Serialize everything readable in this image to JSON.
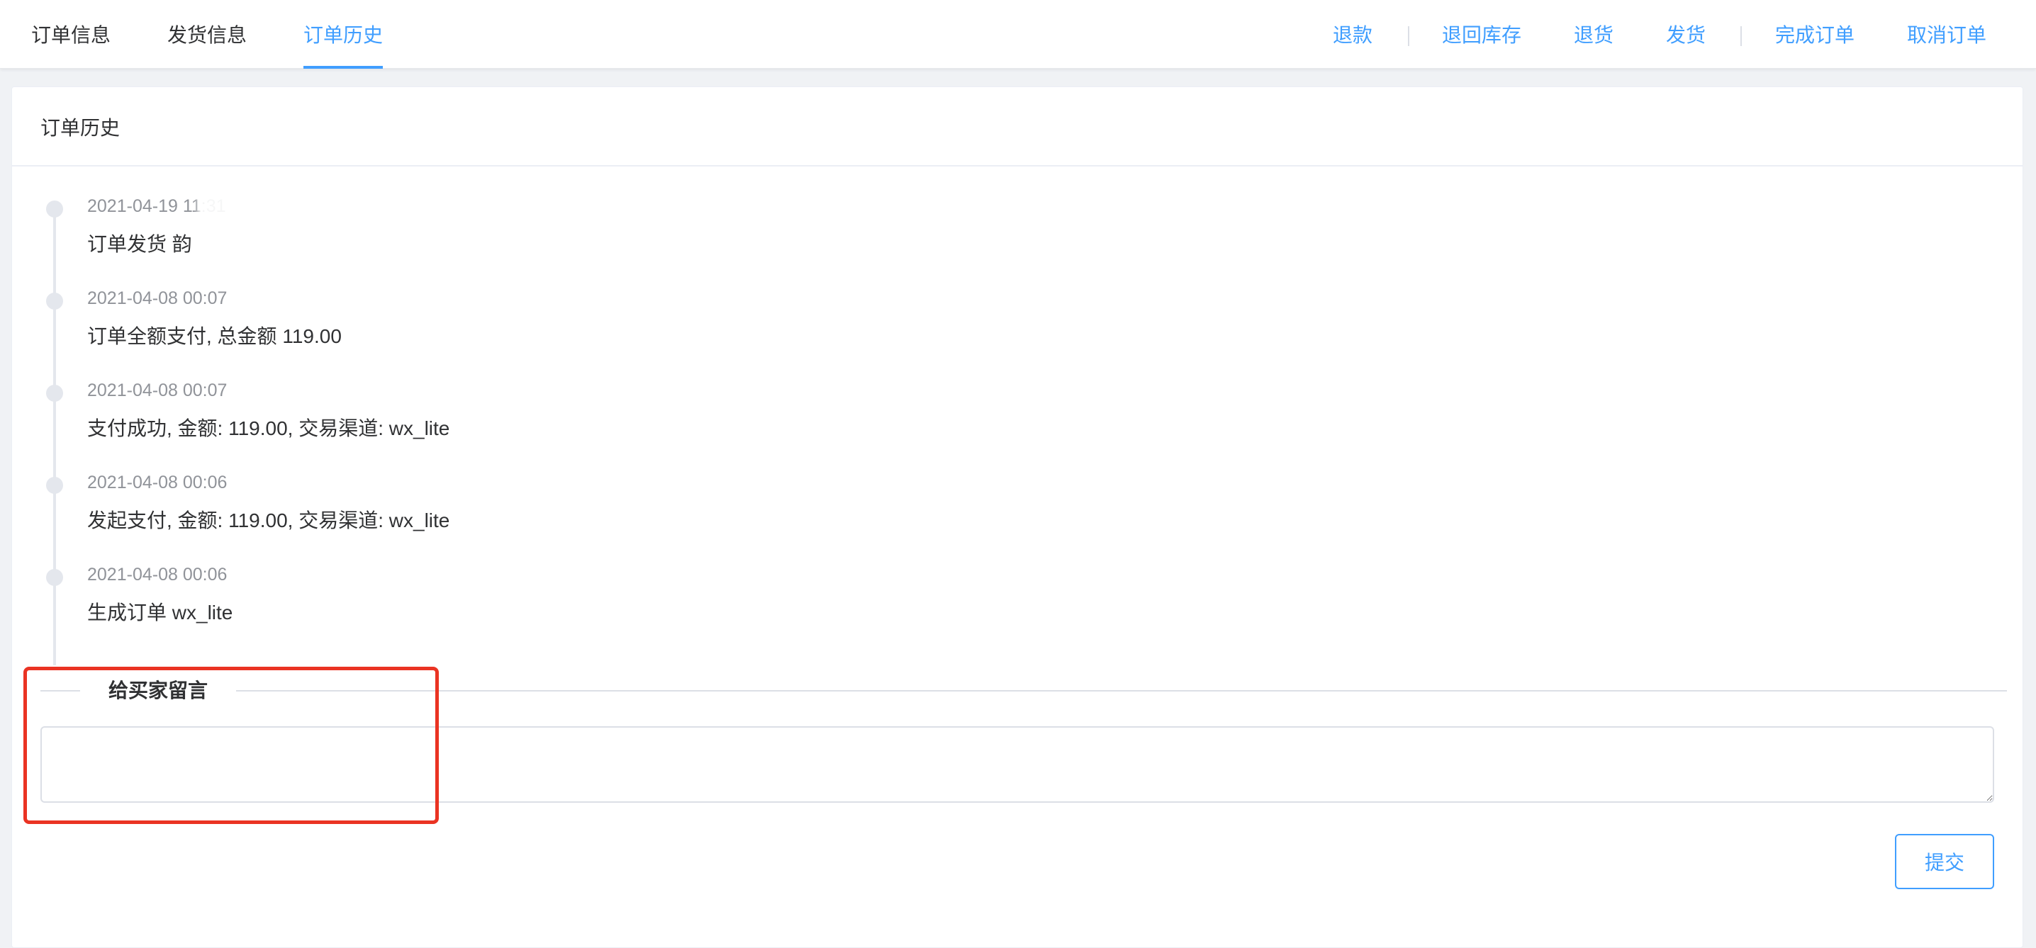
{
  "tabs": {
    "order_info": "订单信息",
    "shipping_info": "发货信息",
    "order_history": "订单历史"
  },
  "actions": {
    "refund": "退款",
    "return_to_stock": "退回库存",
    "return_goods": "退货",
    "ship": "发货",
    "complete_order": "完成订单",
    "cancel_order": "取消订单"
  },
  "card": {
    "title": "订单历史"
  },
  "history": [
    {
      "time": "2021-04-19 11:31",
      "content": "订单发货 韵"
    },
    {
      "time": "2021-04-08 00:07",
      "content": "订单全额支付, 总金额 119.00"
    },
    {
      "time": "2021-04-08 00:07",
      "content": "支付成功, 金额: 119.00, 交易渠道: wx_lite"
    },
    {
      "time": "2021-04-08 00:06",
      "content": "发起支付, 金额: 119.00, 交易渠道: wx_lite"
    },
    {
      "time": "2021-04-08 00:06",
      "content": "生成订单 wx_lite"
    }
  ],
  "message": {
    "title": "给买家留言",
    "value": "",
    "submit_label": "提交"
  },
  "colors": {
    "accent": "#409eff",
    "highlight": "#ea3323",
    "timeline_dot": "#e4e7ed"
  }
}
